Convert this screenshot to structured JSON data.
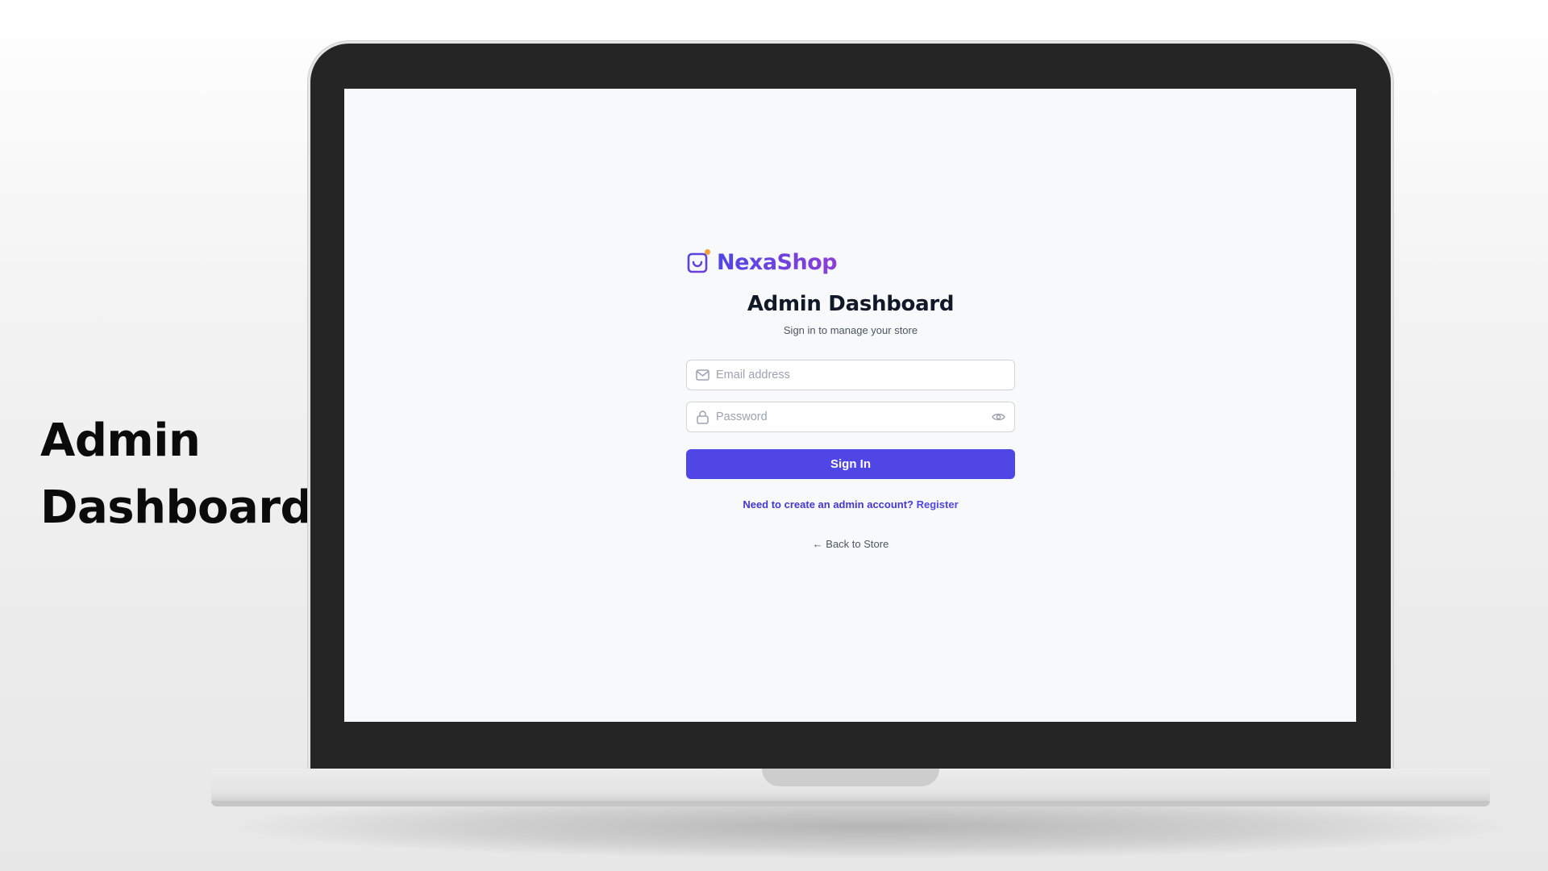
{
  "side": {
    "title_line1": "Admin",
    "title_line2": "Dashboard"
  },
  "brand": {
    "name": "NexaShop",
    "icon": "shopping-bag-icon",
    "colors": {
      "gradient_start": "#4f46e5",
      "gradient_end": "#8b3fd6",
      "dot": "#f59e3b"
    }
  },
  "login": {
    "title": "Admin Dashboard",
    "subtitle": "Sign in to manage your store",
    "email": {
      "placeholder": "Email address",
      "value": "",
      "icon": "mail-icon"
    },
    "password": {
      "placeholder": "Password",
      "value": "",
      "icon": "lock-icon",
      "toggle_icon": "eye-icon"
    },
    "submit_label": "Sign In",
    "register_prompt": "Need to create an admin account?",
    "register_link": "Register",
    "back_link": "← Back to Store"
  },
  "colors": {
    "accent": "#4f46e5",
    "screen_bg": "#f8f9fb",
    "laptop_frame": "#252525"
  }
}
